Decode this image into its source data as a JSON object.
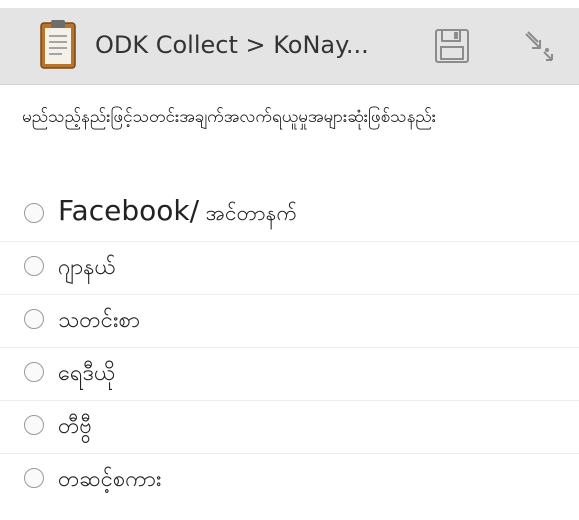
{
  "colors": {
    "actionbar": "#e4e4e4",
    "text": "#222222",
    "radio_border": "#9a9a9a"
  },
  "actionbar": {
    "title": "ODK Collect > KoNay...",
    "app_icon": "clipboard-icon",
    "save_icon": "save-icon",
    "goto_icon": "goto-arrow-icon"
  },
  "question": {
    "text": "မည်သည့်နည်းဖြင့်သတင်းအချက်အလက်ရယူမှုအများဆုံးဖြစ်သနည်း"
  },
  "options": [
    {
      "label_en": "Facebook/",
      "label_rest": " အင်တာနက်"
    },
    {
      "label": "ဂျာနယ်"
    },
    {
      "label": "သတင်းစာ"
    },
    {
      "label": "ရေဒီယို"
    },
    {
      "label": "တီဗွီ"
    },
    {
      "label": "တဆင့်စကား"
    }
  ]
}
